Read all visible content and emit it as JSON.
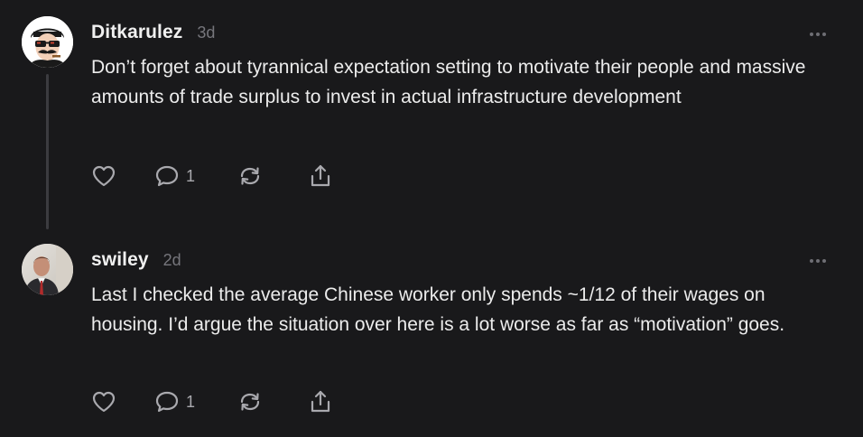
{
  "comments": [
    {
      "author": "Ditkarulez",
      "timestamp": "3d",
      "body": "Don’t forget about tyrannical expectation setting to motivate their people and massive amounts of trade surplus to invest in actual infrastructure development",
      "reply_count": "1",
      "avatar_icon": "mustache-sunglasses-avatar-icon",
      "has_thread_line": true
    },
    {
      "author": "swiley",
      "timestamp": "2d",
      "body": "Last I checked the average Chinese worker only spends ~1/12 of their wages on housing. I’d argue the situation over here is a lot worse as far as “motivation” goes.",
      "reply_count": "1",
      "avatar_icon": "person-photo-avatar-icon",
      "has_thread_line": false
    }
  ],
  "icons": {
    "like": "heart-icon",
    "reply": "speech-bubble-icon",
    "restack": "restack-arrows-icon",
    "share": "share-upload-icon",
    "more": "more-dots-icon"
  },
  "colors": {
    "background": "#19191b",
    "text": "#ececec",
    "muted": "#76767c",
    "icon": "#a9a9ae",
    "thread_line": "#3c3c40"
  }
}
